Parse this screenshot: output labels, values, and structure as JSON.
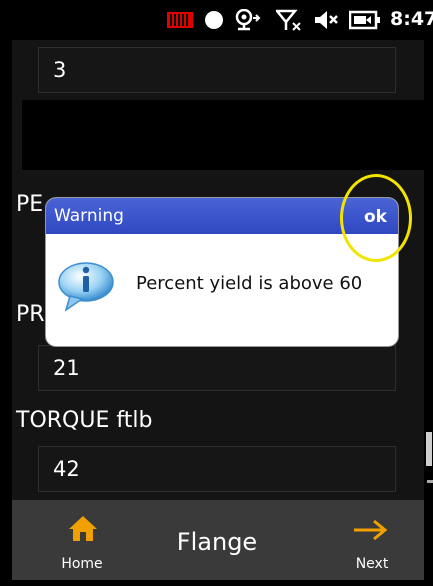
{
  "status_bar": {
    "time": "8:47",
    "icons": [
      "battery-level-icon",
      "record-indicator-icon",
      "network-icon",
      "signal-off-icon",
      "volume-muted-icon",
      "battery-charging-icon"
    ]
  },
  "form": {
    "top_field_value": "3",
    "obscured_label_fragment": "PE",
    "obscured_label_fragment_2": "PR",
    "field_2_value": "21",
    "torque_label": "TORQUE ftlb",
    "torque_value": "42"
  },
  "dialog": {
    "title": "Warning",
    "ok_label": "ok",
    "message": "Percent yield is above 60",
    "icon": "info-speech-bubble-icon"
  },
  "bottom_bar": {
    "home_label": "Home",
    "title": "Flange",
    "next_label": "Next"
  },
  "colors": {
    "dialog_header": "#2f48c2",
    "highlight": "#f2e400",
    "home_icon": "#f0a000",
    "next_icon": "#f0a000"
  }
}
